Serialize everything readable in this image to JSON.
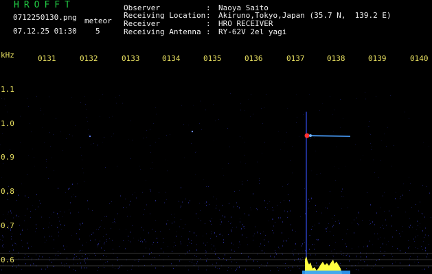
{
  "app": {
    "title": "HROFFT"
  },
  "file": {
    "name": "0712250130.png",
    "datetime": "07.12.25 01:30"
  },
  "meteor": {
    "label": "meteor",
    "count": "5"
  },
  "header": [
    {
      "key": "Observer",
      "value": "Naoya Saito"
    },
    {
      "key": "Receiving Location",
      "value": "Akiruno,Tokyo,Japan (35.7 N,  139.2 E)"
    },
    {
      "key": "Receiver",
      "value": "HRO RECEIVER"
    },
    {
      "key": "Receiving Antenna",
      "value": "RY-62V 2el yagi"
    }
  ],
  "header_colon": ":",
  "axes": {
    "freq_unit": "kHz",
    "freq_ticks": [
      "1.1",
      "1.0",
      "0.9",
      "0.8",
      "0.7",
      "0.6"
    ],
    "time_ticks": [
      "0131",
      "0132",
      "0133",
      "0134",
      "0135",
      "0136",
      "0137",
      "0138",
      "0139",
      "0140"
    ]
  },
  "colors": {
    "background": "#000000",
    "brand": "#22cc44",
    "axis_labels": "#e8e060",
    "noise": "#2a2f9a",
    "echo_core": "#ff3030",
    "echo_tail": "#4aa0ff",
    "meter": "#ffff40",
    "meter_base": "#30a0ff"
  }
}
